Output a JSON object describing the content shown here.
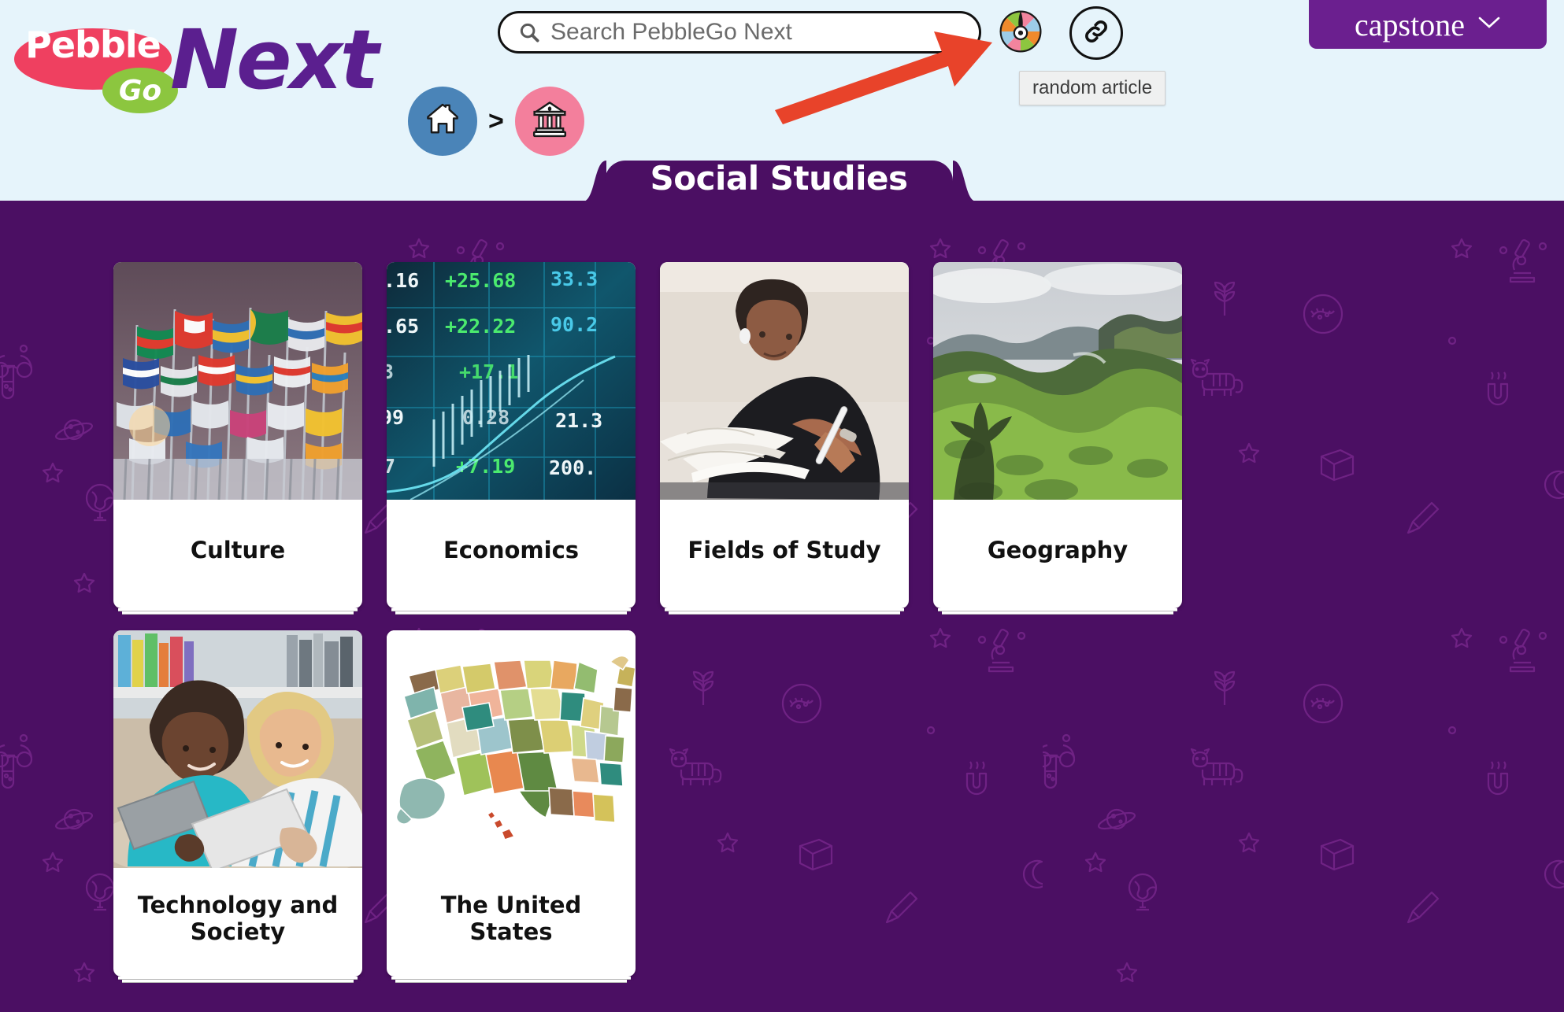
{
  "header": {
    "logo": {
      "pebble": "Pebble",
      "go": "Go",
      "next": "Next"
    },
    "search": {
      "placeholder": "Search PebbleGo Next",
      "value": "",
      "icon": "search-icon"
    },
    "random_button": {
      "icon": "spinner-wheel-icon",
      "tooltip": "random article"
    },
    "link_button": {
      "icon": "link-icon"
    },
    "capstone": {
      "label": "capstone",
      "chevron": "chevron-down-icon"
    },
    "breadcrumb": {
      "items": [
        {
          "icon": "home-icon",
          "name": "home"
        },
        {
          "icon": "bank-building-icon",
          "name": "social-studies"
        }
      ],
      "separator": ">"
    },
    "subject_tab": {
      "label": "Social Studies"
    },
    "annotation": {
      "type": "red-arrow",
      "points_to": "random-article-button",
      "color": "#e8432a"
    }
  },
  "theme": {
    "header_bg": "#e6f4fb",
    "page_bg": "#4b0f63",
    "accent_purple": "#6b1f8f",
    "pebble_pink": "#ef4060",
    "go_green": "#8cc63f",
    "next_purple": "#5b1f8f",
    "home_blue": "#4a84b8",
    "subject_pink": "#f37f9c",
    "arrow_red": "#e8432a"
  },
  "main": {
    "cards": [
      {
        "label": "Culture",
        "thumb": "world-flags-photo"
      },
      {
        "label": "Economics",
        "thumb": "stock-ticker-photo"
      },
      {
        "label": "Fields of Study",
        "thumb": "student-studying-photo"
      },
      {
        "label": "Geography",
        "thumb": "green-mountain-landscape-photo"
      },
      {
        "label": "Technology and Society",
        "thumb": "kids-with-tablets-photo"
      },
      {
        "label": "The United States",
        "thumb": "united-states-map-illustration"
      }
    ]
  }
}
